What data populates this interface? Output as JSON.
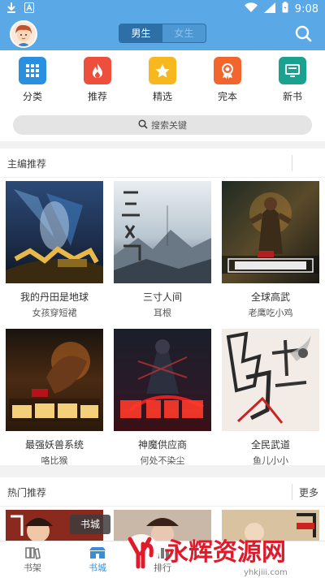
{
  "status_bar": {
    "time": "9:08"
  },
  "header": {
    "segments": [
      {
        "label": "男生",
        "active": true
      },
      {
        "label": "女生",
        "active": false
      }
    ]
  },
  "categories": [
    {
      "label": "分类",
      "icon": "grid-icon",
      "color": "#2b8fe0"
    },
    {
      "label": "推荐",
      "icon": "flame-icon",
      "color": "#ee4f3d"
    },
    {
      "label": "精选",
      "icon": "star-icon",
      "color": "#f6b81e"
    },
    {
      "label": "完本",
      "icon": "medal-icon",
      "color": "#f2662d"
    },
    {
      "label": "新书",
      "icon": "monitor-icon",
      "color": "#1aa18f"
    }
  ],
  "search": {
    "placeholder": "搜索关键"
  },
  "editor_section": {
    "title": "主编推荐",
    "books": [
      {
        "title": "我的丹田是地球",
        "author": "女孩穿短裙"
      },
      {
        "title": "三寸人间",
        "author": "耳根"
      },
      {
        "title": "全球高武",
        "author": "老鹰吃小鸡"
      },
      {
        "title": "最强妖兽系统",
        "author": "咯比猴"
      },
      {
        "title": "神魔供应商",
        "author": "何处不染尘"
      },
      {
        "title": "全民武道",
        "author": "鱼儿小小"
      }
    ]
  },
  "hot_section": {
    "title": "热门推荐",
    "more": "更多"
  },
  "float_label": "书城",
  "tabs": [
    {
      "label": "书架",
      "icon": "bookshelf-icon",
      "active": false
    },
    {
      "label": "书城",
      "icon": "store-icon",
      "active": true
    },
    {
      "label": "排行",
      "icon": "ranking-icon",
      "active": false
    }
  ],
  "watermark": {
    "text": "永辉资源网",
    "sub": "yhkjiii.com"
  },
  "colors": {
    "primary": "#5aa8e6",
    "segment_active": "#2f6fa8"
  }
}
